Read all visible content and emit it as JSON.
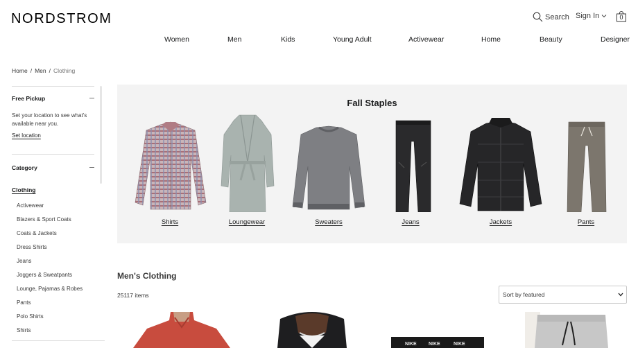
{
  "header": {
    "logo": "NORDSTROM",
    "search_label": "Search",
    "signin_label": "Sign In",
    "bag_count": "0"
  },
  "nav": {
    "items": [
      "Women",
      "Men",
      "Kids",
      "Young Adult",
      "Activewear",
      "Home",
      "Beauty",
      "Designer"
    ]
  },
  "breadcrumb": {
    "home": "Home",
    "sep": "/",
    "men": "Men",
    "current": "Clothing"
  },
  "sidebar": {
    "pickup_heading": "Free Pickup",
    "pickup_text": "Set your location to see what's available near you.",
    "pickup_link": "Set location",
    "category_heading": "Category",
    "active_category": "Clothing",
    "categories": [
      "Activewear",
      "Blazers & Sport Coats",
      "Coats & Jackets",
      "Dress Shirts",
      "Jeans",
      "Joggers & Sweatpants",
      "Lounge, Pajamas & Robes",
      "Pants",
      "Polo Shirts",
      "Shirts"
    ]
  },
  "staples": {
    "title": "Fall Staples",
    "items": [
      {
        "label": "Shirts",
        "icon": "plaid-shirt-image"
      },
      {
        "label": "Loungewear",
        "icon": "robe-image"
      },
      {
        "label": "Sweaters",
        "icon": "sweater-image"
      },
      {
        "label": "Jeans",
        "icon": "black-jeans-image"
      },
      {
        "label": "Jackets",
        "icon": "puffer-jacket-image"
      },
      {
        "label": "Pants",
        "icon": "jogger-pants-image"
      }
    ]
  },
  "products": {
    "title": "Men's Clothing",
    "count": "25117 items",
    "sort_value": "Sort by featured"
  },
  "colors": {
    "panel_bg": "#f3f3f3",
    "text": "#191a1b"
  }
}
